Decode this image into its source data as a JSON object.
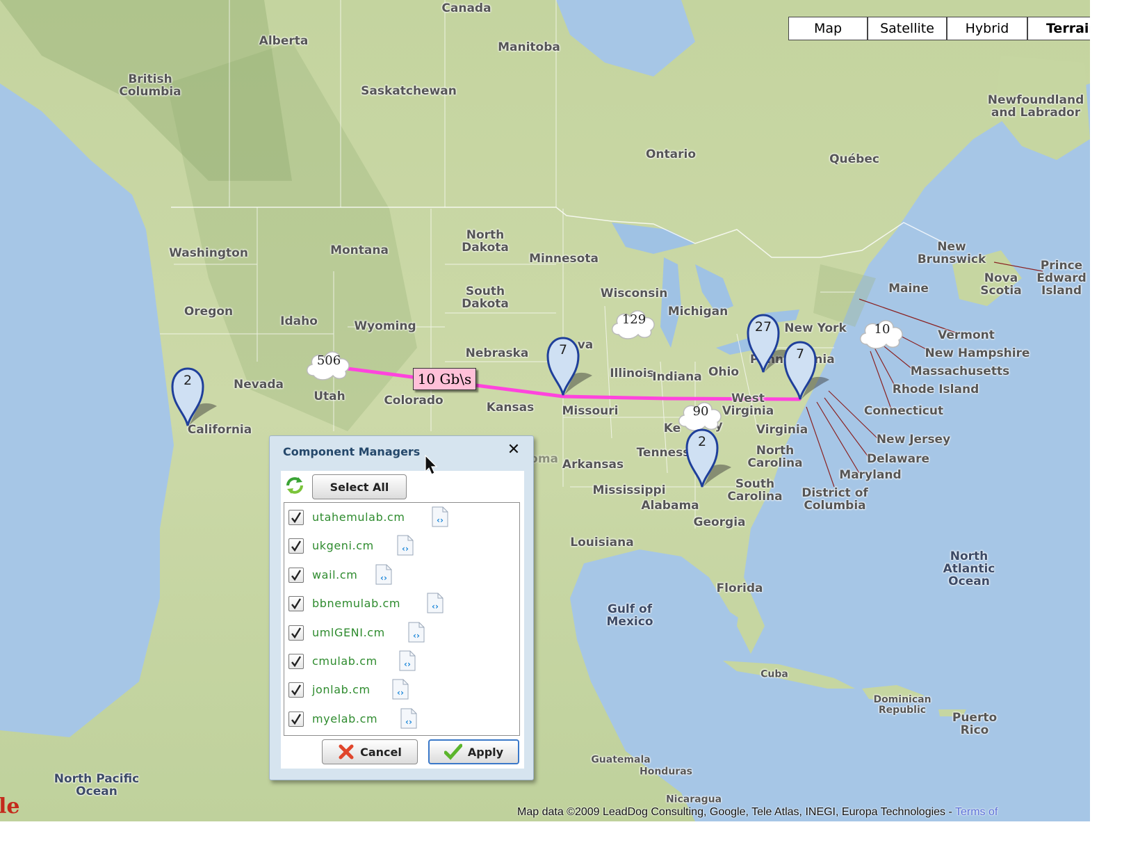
{
  "map_types": [
    {
      "label": "Map",
      "active": false
    },
    {
      "label": "Satellite",
      "active": false
    },
    {
      "label": "Hybrid",
      "active": false
    },
    {
      "label": "Terrain",
      "active": true
    }
  ],
  "place_labels": {
    "canada": "Canada",
    "alberta": "Alberta",
    "manitoba": "Manitoba",
    "british_columbia": "British\nColumbia",
    "saskatchewan": "Saskatchewan",
    "newfoundland": "Newfoundland\nand Labrador",
    "ontario": "Ontario",
    "quebec": "Québec",
    "washington": "Washington",
    "montana": "Montana",
    "north_dakota": "North\nDakota",
    "minnesota": "Minnesota",
    "new_brunswick": "New\nBrunswick",
    "prince_edward_island": "Prince\nEdward\nIsland",
    "nova_scotia": "Nova\nScotia",
    "maine": "Maine",
    "south_dakota": "South\nDakota",
    "wisconsin": "Wisconsin",
    "michigan": "Michigan",
    "oregon": "Oregon",
    "idaho": "Idaho",
    "wyoming": "Wyoming",
    "new_york": "New York",
    "vermont": "Vermont",
    "nebraska": "Nebraska",
    "iowa_partial": "va",
    "new_hampshire": "New Hampshire",
    "illinois": "Illinois",
    "indiana": "Indiana",
    "ohio": "Ohio",
    "pennsylvania_partial_a": "Penn",
    "pennsylvania_partial_b": "nia",
    "massachusetts": "Massachusetts",
    "nevada": "Nevada",
    "utah": "Utah",
    "colorado": "Colorado",
    "kansas": "Kansas",
    "missouri": "Missouri",
    "west_virginia_a": "West",
    "west_virginia_b": "Virginia",
    "rhode_island": "Rhode Island",
    "connecticut": "Connecticut",
    "california": "California",
    "kentucky_partial_a": "Ke",
    "kentucky_partial_b": "y",
    "virginia": "Virginia",
    "new_jersey": "New Jersey",
    "oklahoma_partial": "Oklahoma",
    "arkansas": "Arkansas",
    "tennessee_partial": "Tenness",
    "north_carolina": "North\nCarolina",
    "delaware": "Delaware",
    "maryland": "Maryland",
    "mississippi": "Mississippi",
    "south_carolina": "South\nCarolina",
    "district_of_columbia": "District of\nColumbia",
    "alabama": "Alabama",
    "georgia": "Georgia",
    "louisiana": "Louisiana",
    "north_atlantic": "North\nAtlantic\nOcean",
    "florida": "Florida",
    "gulf_of_mexico": "Gulf of\nMexico",
    "cuba": "Cuba",
    "dominican_republic": "Dominican\nRepublic",
    "puerto_rico": "Puerto\nRico",
    "guatemala": "Guatemala",
    "honduras": "Honduras",
    "north_pacific": "North Pacific\nOcean",
    "nicaragua": "Nicaragua"
  },
  "markers": [
    {
      "id": "california",
      "count": "2"
    },
    {
      "id": "missouri",
      "count": "7"
    },
    {
      "id": "pennsylvania",
      "count": "27"
    },
    {
      "id": "maryland",
      "count": "7"
    },
    {
      "id": "georgia",
      "count": "2"
    }
  ],
  "clusters": [
    {
      "id": "utah",
      "count": "506"
    },
    {
      "id": "wisconsin",
      "count": "129"
    },
    {
      "id": "kentucky",
      "count": "90"
    },
    {
      "id": "new-england",
      "count": "10"
    }
  ],
  "link": {
    "label": "10 Gb\\s",
    "color": "#ff44dd"
  },
  "attribution": {
    "text": "Map data ©2009  LeadDog Consulting, Google, Tele Atlas, INEGI, Europa Technologies - ",
    "terms": "Terms of"
  },
  "logo_fragment": "le",
  "dialog": {
    "title": "Component Managers",
    "select_all": "Select All",
    "cancel": "Cancel",
    "apply": "Apply",
    "managers": [
      {
        "name": "utahemulab.cm",
        "checked": true
      },
      {
        "name": "ukgeni.cm",
        "checked": true
      },
      {
        "name": "wail.cm",
        "checked": true
      },
      {
        "name": "bbnemulab.cm",
        "checked": true
      },
      {
        "name": "umlGENI.cm",
        "checked": true
      },
      {
        "name": "cmulab.cm",
        "checked": true
      },
      {
        "name": "jonlab.cm",
        "checked": true
      },
      {
        "name": "myelab.cm",
        "checked": true
      }
    ]
  },
  "colors": {
    "ocean": "#a6c6e6",
    "land": "#c9d9a6",
    "marker_fill": "#cfe0f3",
    "marker_stroke": "#1f3f9a",
    "label_pink": "#ffc0d8",
    "link_text_green": "#2e8b2e"
  }
}
